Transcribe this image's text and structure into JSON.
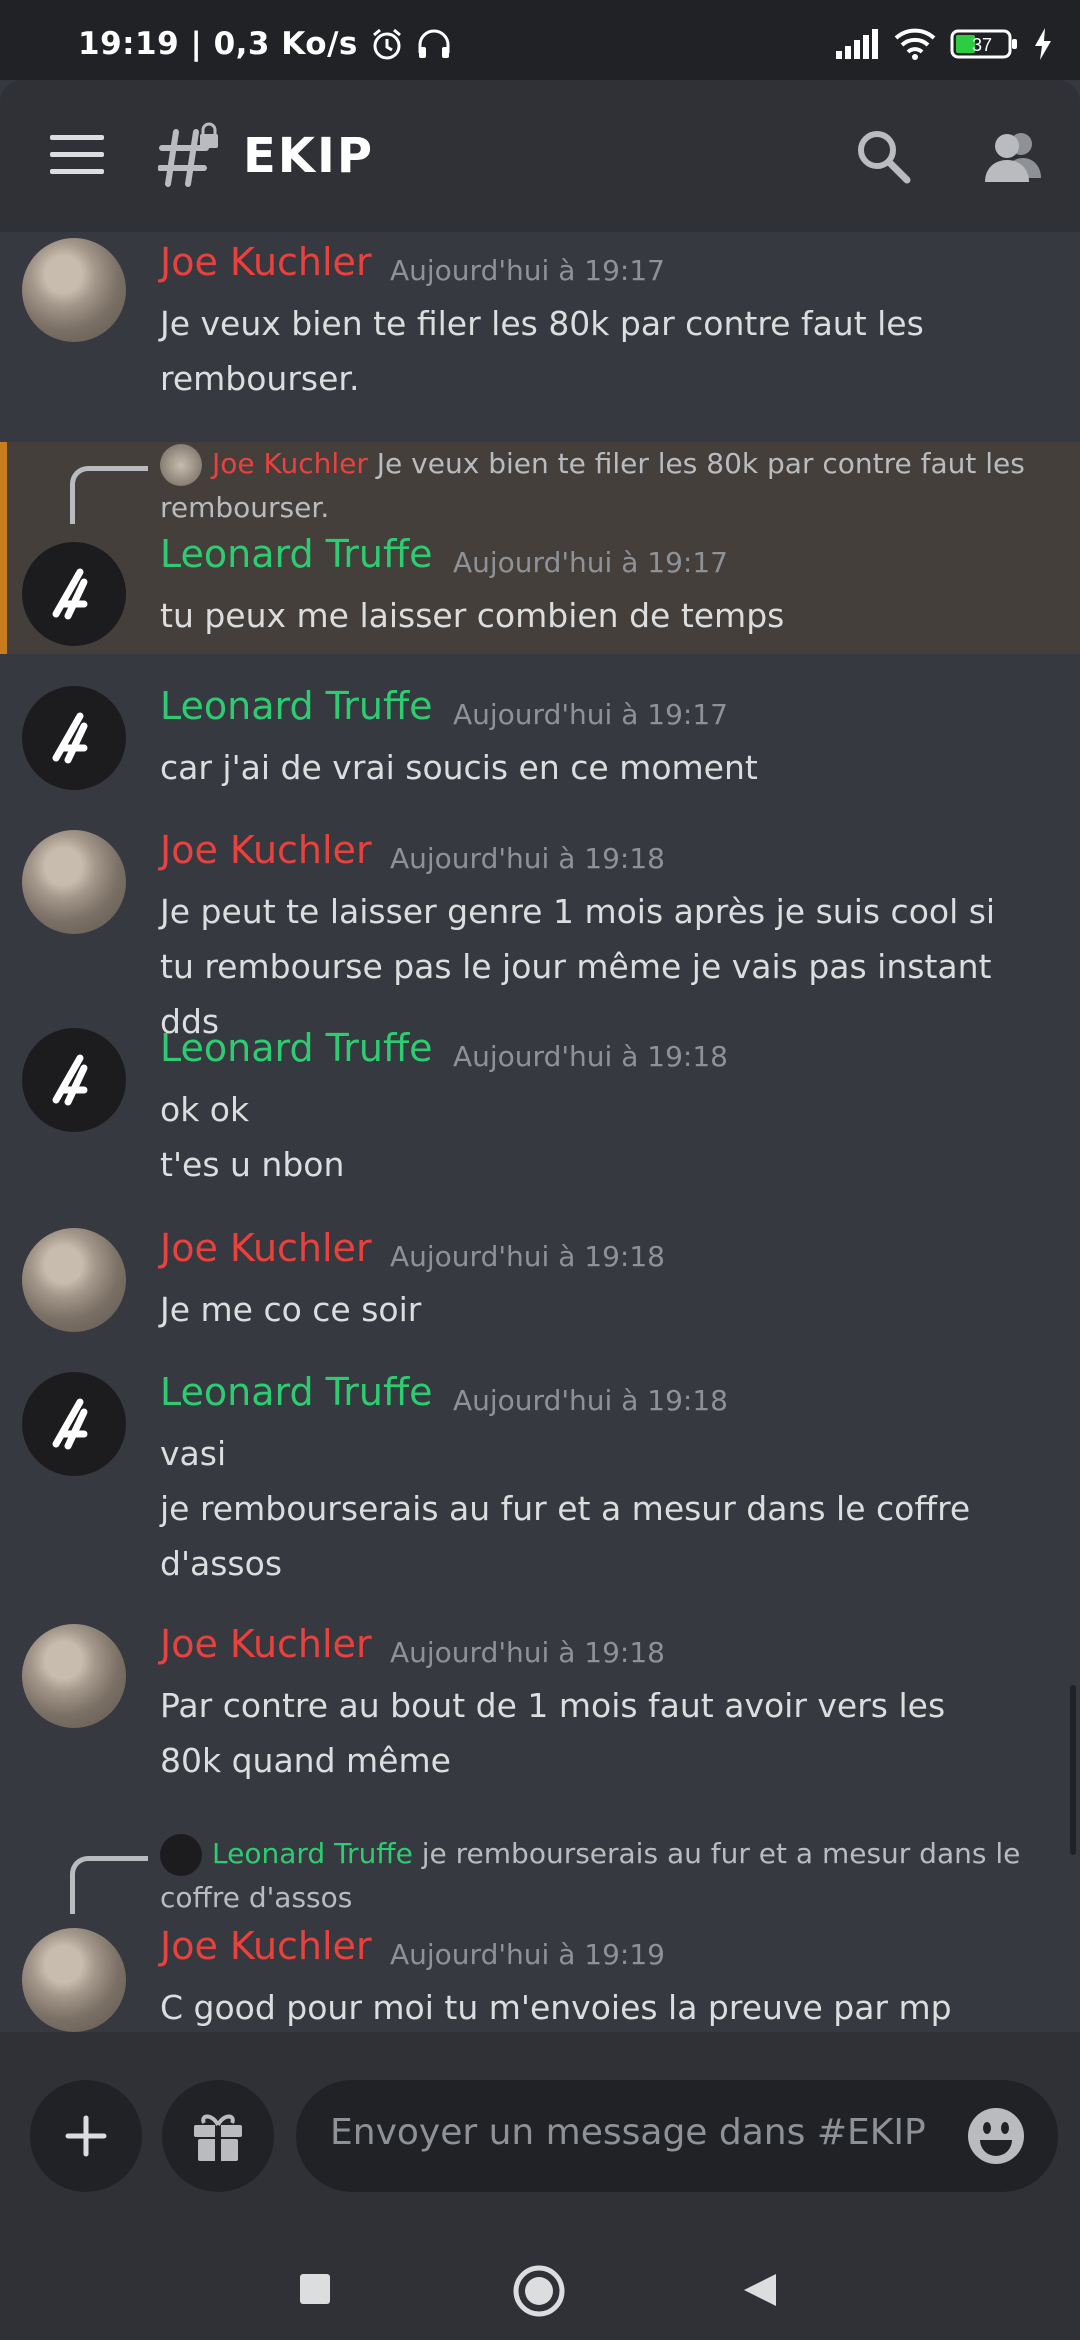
{
  "status_bar": {
    "time": "19:19 | 0,3 Ko/s",
    "battery": "37"
  },
  "header": {
    "channel_name": "EKIP"
  },
  "messages": [
    {
      "author": "Joe Kuchler",
      "timestamp": "Aujourd'hui à 19:17",
      "text": "Je veux bien te filer les 80k par contre faut les rembourser."
    },
    {
      "reply_to": {
        "author": "Joe Kuchler",
        "text": "Je veux bien te filer les 80k par contre faut les rembourser."
      },
      "author": "Leonard Truffe",
      "timestamp": "Aujourd'hui à 19:17",
      "text": "tu peux me laisser combien de temps"
    },
    {
      "author": "Leonard Truffe",
      "timestamp": "Aujourd'hui à 19:17",
      "text": "car j'ai de vrai soucis en ce moment"
    },
    {
      "author": "Joe Kuchler",
      "timestamp": "Aujourd'hui à 19:18",
      "text": "Je peut te laisser genre 1 mois après je suis cool si tu rembourse pas le jour même je vais pas instant dds"
    },
    {
      "author": "Leonard Truffe",
      "timestamp": "Aujourd'hui à 19:18",
      "text": "ok ok\nt'es u nbon"
    },
    {
      "author": "Joe Kuchler",
      "timestamp": "Aujourd'hui à 19:18",
      "text": "Je me co ce soir"
    },
    {
      "author": "Leonard Truffe",
      "timestamp": "Aujourd'hui à 19:18",
      "text": "vasi\nje rembourserais au fur et a mesur dans le coffre d'assos"
    },
    {
      "author": "Joe Kuchler",
      "timestamp": "Aujourd'hui à 19:18",
      "text": "Par contre au bout de 1 mois faut avoir vers les 80k quand même"
    },
    {
      "reply_to": {
        "author": "Leonard Truffe",
        "text": "je rembourserais au fur et a mesur dans le coffre d'assos"
      },
      "author": "Joe Kuchler",
      "timestamp": "Aujourd'hui à 19:19",
      "text": "C good pour moi tu m'envoies la preuve par mp discord"
    }
  ],
  "composer": {
    "placeholder": "Envoyer un message dans #EKIP"
  },
  "colors": {
    "background": "#36393f",
    "header": "#2f3136",
    "joe_name": "#e8423f",
    "leonard_name": "#2ecc71",
    "highlight": "#443f3b",
    "highlight_bar": "#c87c1d"
  }
}
